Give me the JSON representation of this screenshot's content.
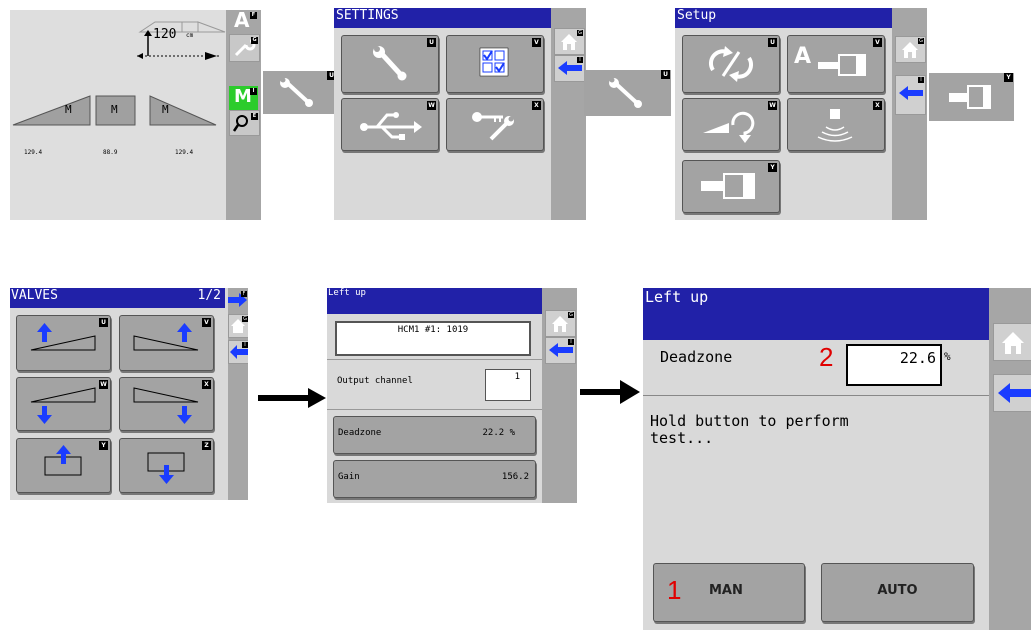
{
  "screen1": {
    "distance": "120",
    "unit": "cm",
    "sections": [
      "M",
      "M",
      "M"
    ],
    "values": [
      "129.4",
      "88.9",
      "129.4"
    ],
    "sidebar": [
      {
        "glyph": "A",
        "badge": "F"
      },
      {
        "glyph": "wrench",
        "badge": "G"
      },
      {
        "glyph": "M",
        "badge": "I"
      },
      {
        "glyph": "search",
        "badge": "E"
      }
    ]
  },
  "connector1_badge": "U",
  "screen2": {
    "title": "SETTINGS",
    "tiles": [
      {
        "icon": "wrench-icon",
        "badge": "U"
      },
      {
        "icon": "checklist-icon",
        "badge": "V"
      },
      {
        "icon": "usb-icon",
        "badge": "W"
      },
      {
        "icon": "key-wrench-icon",
        "badge": "X"
      }
    ],
    "side_badges": [
      "G",
      "I"
    ]
  },
  "connector2_badge": "U",
  "screen3": {
    "title": "Setup",
    "tiles": [
      {
        "icon": "sync-icon",
        "badge": "U"
      },
      {
        "icon": "boom-height-icon",
        "badge": "V",
        "letter": "A"
      },
      {
        "icon": "tilt-icon",
        "badge": "W"
      },
      {
        "icon": "sensor-icon",
        "badge": "X"
      },
      {
        "icon": "cylinder-icon",
        "badge": "Y"
      }
    ],
    "side_badges": [
      "G",
      "I"
    ]
  },
  "connector3_badge": "Y",
  "screen4": {
    "title": "VALVES",
    "page": "1/2",
    "badges": [
      "U",
      "V",
      "W",
      "X",
      "Y",
      "Z"
    ],
    "side_badges": [
      "F",
      "G",
      "I"
    ]
  },
  "screen5": {
    "title": "Left up",
    "device": "HCM1 #1: 1019",
    "output_label": "Output channel",
    "output_value": "1",
    "rows": [
      {
        "label": "Deadzone",
        "value": "22.2 %"
      },
      {
        "label": "Gain",
        "value": "156.2"
      }
    ],
    "side_badges": [
      "G",
      "I"
    ]
  },
  "screen6": {
    "title": "Left up",
    "deadzone_label": "Deadzone",
    "marker2": "2",
    "deadzone_value": "22.6",
    "unit": "%",
    "message": "Hold button to perform test...",
    "marker1": "1",
    "man_label": "MAN",
    "auto_label": "AUTO"
  },
  "colors": {
    "header": "#2121a8",
    "arrow": "#1a3cff",
    "badge_red": "#e00000"
  }
}
